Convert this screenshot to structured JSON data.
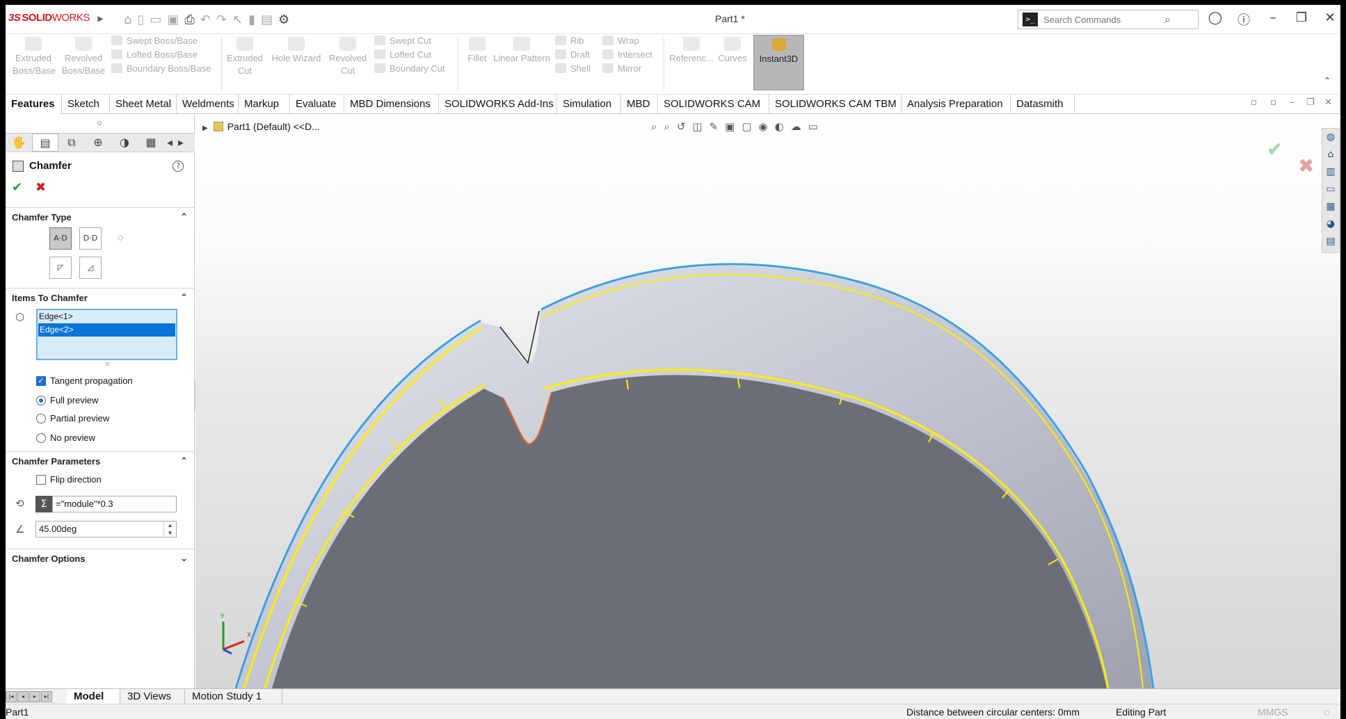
{
  "app": {
    "brand_prefix": "3S",
    "brand_bold": "SOLID",
    "brand_rest": "WORKS",
    "document_title": "Part1 *"
  },
  "search": {
    "placeholder": "Search Commands"
  },
  "ribbon": {
    "extruded_boss": [
      "Extruded",
      "Boss/Base"
    ],
    "revolved_boss": [
      "Revolved",
      "Boss/Base"
    ],
    "swept_boss": "Swept Boss/Base",
    "lofted_boss": "Lofted Boss/Base",
    "boundary_boss": "Boundary Boss/Base",
    "extruded_cut": [
      "Extruded",
      "Cut"
    ],
    "hole_wizard": "Hole Wizard",
    "revolved_cut": [
      "Revolved",
      "Cut"
    ],
    "swept_cut": "Swept Cut",
    "lofted_cut": "Lofted Cut",
    "boundary_cut": "Boundary Cut",
    "fillet": "Fillet",
    "linear_pattern": "Linear Pattern",
    "rib": "Rib",
    "draft": "Draft",
    "shell": "Shell",
    "wrap": "Wrap",
    "intersect": "Intersect",
    "mirror": "Mirror",
    "reference": "Referenc...",
    "curves": "Curves",
    "instant3d": "Instant3D"
  },
  "tabs": [
    "Features",
    "Sketch",
    "Sheet Metal",
    "Weldments",
    "Markup",
    "Evaluate",
    "MBD Dimensions",
    "SOLIDWORKS Add-Ins",
    "Simulation",
    "MBD",
    "SOLIDWORKS CAM",
    "SOLIDWORKS CAM TBM",
    "Analysis Preparation",
    "Datasmith"
  ],
  "property_manager": {
    "title": "Chamfer",
    "help": "?",
    "sections": {
      "chamfer_type": "Chamfer Type",
      "items_to_chamfer": "Items To Chamfer",
      "chamfer_parameters": "Chamfer Parameters",
      "chamfer_options": "Chamfer Options"
    },
    "items": [
      "Edge<1>",
      "Edge<2>"
    ],
    "tangent_propagation": "Tangent propagation",
    "full_preview": "Full preview",
    "partial_preview": "Partial preview",
    "no_preview": "No preview",
    "flip_direction": "Flip direction",
    "distance_value": "=\"module\"*0.3",
    "angle_value": "45.00deg"
  },
  "view": {
    "tree_label": "Part1 (Default) <<D...",
    "triad_x": "X",
    "triad_y": "Y"
  },
  "bottom_tabs": [
    "Model",
    "3D Views",
    "Motion Study 1"
  ],
  "status": {
    "doc": "Part1",
    "measure": "Distance between circular centers: 0mm",
    "mode": "Editing Part",
    "units": "MMGS"
  }
}
